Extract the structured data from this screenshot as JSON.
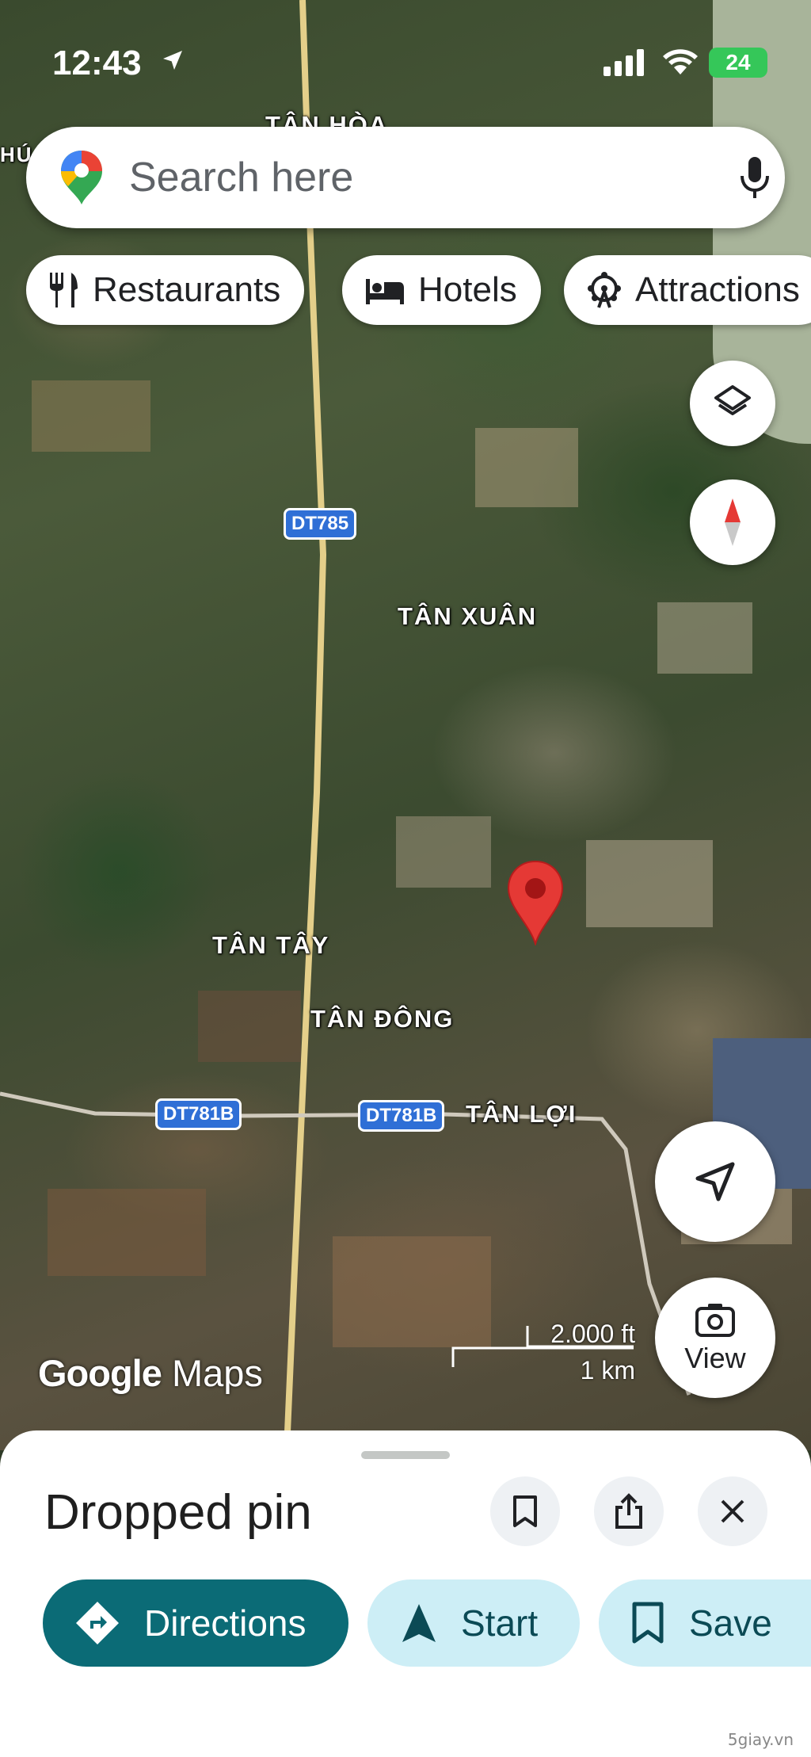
{
  "status_bar": {
    "time": "12:43",
    "battery": "24"
  },
  "search": {
    "placeholder": "Search here",
    "logo_icon": "google-maps-pin-icon",
    "mic_icon": "microphone-icon"
  },
  "chips": [
    {
      "label": "Restaurants",
      "icon": "fork-knife-icon"
    },
    {
      "label": "Hotels",
      "icon": "bed-icon"
    },
    {
      "label": "Attractions",
      "icon": "ferris-wheel-icon"
    }
  ],
  "map": {
    "road_labels": [
      "DT785",
      "DT781B",
      "DT781B"
    ],
    "place_labels": [
      "TÂN HÒA",
      "TÂN XUÂN",
      "TÂN TÂY",
      "TÂN ĐÔNG",
      "TÂN LỢI",
      "HÚ"
    ],
    "scale_ft": "2.000 ft",
    "scale_km": "1 km",
    "brand_google": "Google",
    "brand_maps": "Maps",
    "view_label": "View"
  },
  "sheet": {
    "title": "Dropped pin",
    "actions": {
      "directions": "Directions",
      "start": "Start",
      "save": "Save"
    }
  },
  "watermark": "5giay.vn",
  "colors": {
    "primary_teal": "#0b6b76",
    "secondary_chip": "#cdeef6",
    "pin_red": "#e53935",
    "road_shield": "#2f6fd6"
  }
}
